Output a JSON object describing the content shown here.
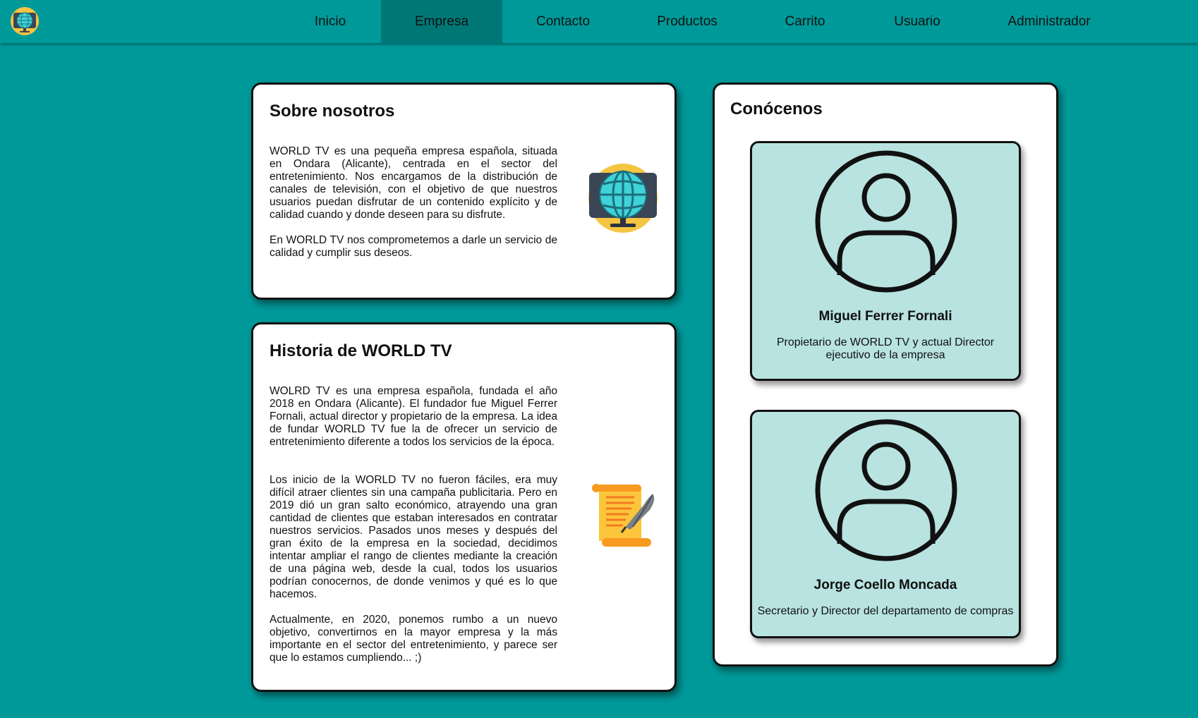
{
  "nav": {
    "items": [
      {
        "label": "Inicio"
      },
      {
        "label": "Empresa"
      },
      {
        "label": "Contacto"
      },
      {
        "label": "Productos"
      },
      {
        "label": "Carrito"
      },
      {
        "label": "Usuario"
      },
      {
        "label": "Administrador"
      }
    ],
    "active": "Empresa",
    "logo_icon": "globe-tv-icon"
  },
  "about": {
    "title": "Sobre nosotros",
    "paragraphs": [
      "WORLD TV es una pequeña empresa española, situada en Ondara (Alicante), centrada en el sector del entretenimiento. Nos encargamos de la distribución de canales de televisión, con el objetivo de que nuestros usuarios puedan disfrutar de un contenido explícito y de calidad cuando y donde deseen para su disfrute.",
      "En WORLD TV nos comprometemos a darle un servicio de calidad y cumplir sus deseos."
    ],
    "image_icon": "globe-tv-icon"
  },
  "history": {
    "title": "Historia de WORLD TV",
    "paragraphs": [
      "WOLRD TV es una empresa española, fundada el año 2018 en Ondara (Alicante). El fundador fue Miguel Ferrer Fornali, actual director y propietario de la empresa. La idea de fundar WORLD TV fue la de ofrecer un servicio de entretenimiento diferente a todos los servicios de la época.",
      "Los inicio de la WORLD TV no fueron fáciles, era muy difícil atraer clientes sin una campaña publicitaria. Pero en 2019 dió un gran salto económico, atrayendo una gran cantidad de clientes que estaban interesados en contratar nuestros servicios. Pasados unos meses y después del gran éxito de la empresa en la sociedad, decidimos intentar ampliar el rango de clientes mediante la creación de una página web, desde la cual, todos los usuarios podrían conocernos, de donde venimos y qué es lo que hacemos.",
      "Actualmente, en 2020, ponemos rumbo a un nuevo objetivo, convertirnos en la mayor empresa y la más importante en el sector del entretenimiento, y parece ser que lo estamos cumpliendo... ;)"
    ],
    "image_icon": "scroll-quill-icon"
  },
  "team": {
    "title": "Conócenos",
    "members": [
      {
        "name": "Miguel Ferrer Fornali",
        "role": "Propietario de WORLD TV y actual Director ejecutivo de la empresa",
        "icon": "user-avatar-icon"
      },
      {
        "name": "Jorge Coello Moncada",
        "role": "Secretario y Director del departamento de compras",
        "icon": "user-avatar-icon"
      }
    ]
  },
  "colors": {
    "background": "#009999",
    "nav_active": "#007777",
    "member_card": "#b8e3e1",
    "card": "#ffffff"
  }
}
